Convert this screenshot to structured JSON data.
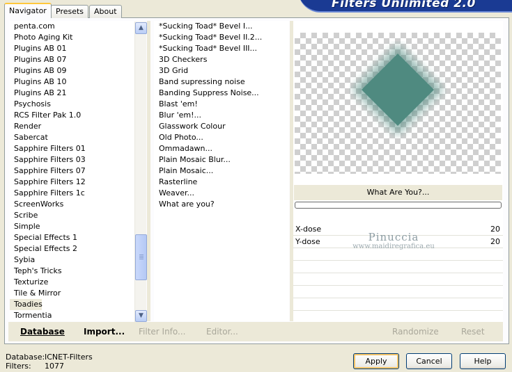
{
  "tabs": [
    "Navigator",
    "Presets",
    "About"
  ],
  "brand": "Filters Unlimited 2.0",
  "categories": [
    "penta.com",
    "Photo Aging Kit",
    "Plugins AB 01",
    "Plugins AB 07",
    "Plugins AB 09",
    "Plugins AB 10",
    "Plugins AB 21",
    "Psychosis",
    "RCS Filter Pak 1.0",
    "Render",
    "Sabercat",
    "Sapphire Filters 01",
    "Sapphire Filters 03",
    "Sapphire Filters 07",
    "Sapphire Filters 12",
    "Sapphire Filters 1c",
    "ScreenWorks",
    "Scribe",
    "Simple",
    "Special Effects 1",
    "Special Effects 2",
    "Sybia",
    "Teph's Tricks",
    "Texturize",
    "Tile & Mirror",
    "Toadies",
    "Tormentia"
  ],
  "selected_category": "Toadies",
  "filters": [
    "*Sucking Toad*  Bevel I...",
    "*Sucking Toad*  Bevel II.2...",
    "*Sucking Toad*  Bevel III...",
    "3D Checkers",
    "3D Grid",
    "Band supressing noise",
    "Banding Suppress Noise...",
    "Blast 'em!",
    "Blur 'em!...",
    "Glasswork Colour",
    "Old Photo...",
    "Ommadawn...",
    "Plain Mosaic Blur...",
    "Plain Mosaic...",
    "Rasterline",
    "Weaver...",
    "What are you?"
  ],
  "selected_filter": "What Are You?...",
  "preview_color": "#4f8a80",
  "progress": 0,
  "params": [
    {
      "label": "X-dose",
      "value": "20"
    },
    {
      "label": "Y-dose",
      "value": "20"
    }
  ],
  "watermark": {
    "line1": "Pinuccia",
    "line2": "www.maidiregrafica.eu"
  },
  "toolbar": {
    "database": "Database",
    "import": "Import...",
    "filter_info": "Filter Info...",
    "editor": "Editor...",
    "randomize": "Randomize",
    "reset": "Reset"
  },
  "info": {
    "database_label": "Database:",
    "database_value": "ICNET-Filters",
    "filters_label": "Filters:",
    "filters_value": "1077"
  },
  "buttons": {
    "apply": "Apply",
    "cancel": "Cancel",
    "help": "Help"
  }
}
